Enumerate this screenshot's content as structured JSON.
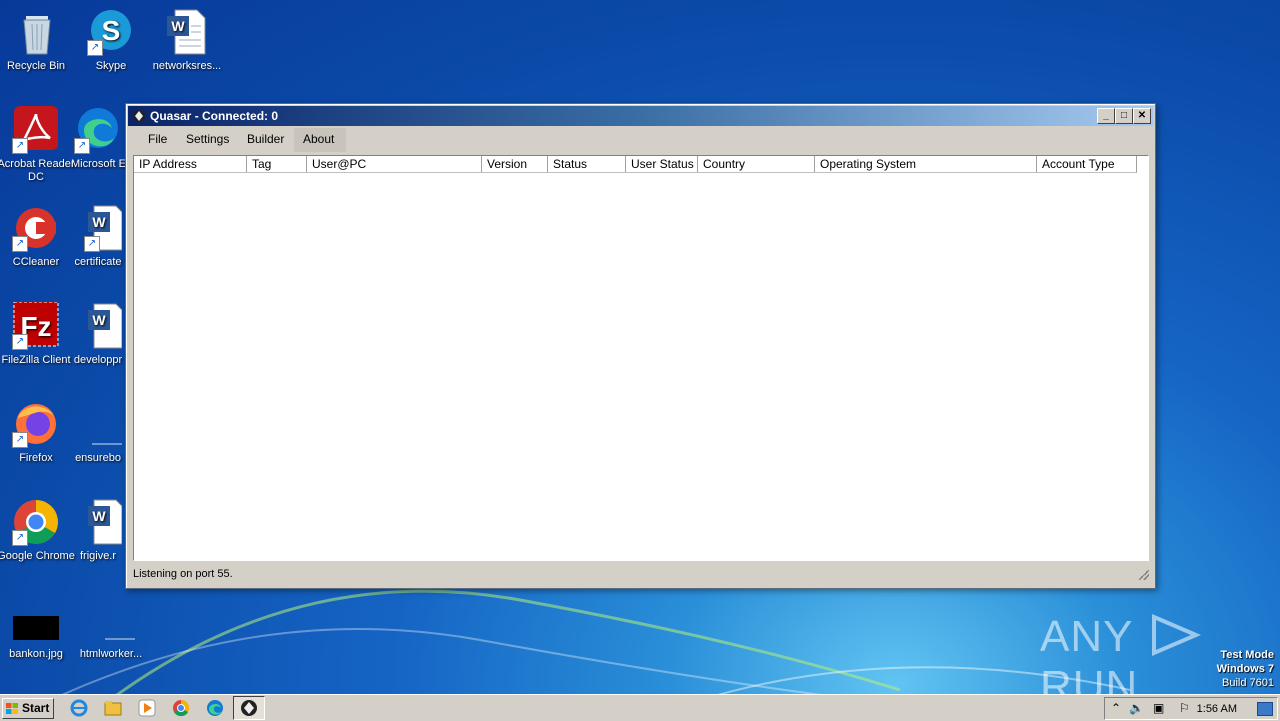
{
  "desktop": {
    "icons": [
      {
        "label": "Recycle Bin"
      },
      {
        "label": "Skype"
      },
      {
        "label": "networksres..."
      },
      {
        "label": "Acrobat Reader DC"
      },
      {
        "label": "Microsoft E"
      },
      {
        "label": "CCleaner"
      },
      {
        "label": "certificate"
      },
      {
        "label": "FileZilla Client"
      },
      {
        "label": "developpr"
      },
      {
        "label": "Firefox"
      },
      {
        "label": "ensurebo"
      },
      {
        "label": "Google Chrome"
      },
      {
        "label": "frigive.r"
      },
      {
        "label": "bankon.jpg"
      },
      {
        "label": "htmlworker..."
      }
    ]
  },
  "window": {
    "title": "Quasar - Connected: 0",
    "menu": [
      "File",
      "Settings",
      "Builder",
      "About"
    ],
    "columns": [
      "IP Address",
      "Tag",
      "User@PC",
      "Version",
      "Status",
      "User Status",
      "Country",
      "Operating System",
      "Account Type"
    ],
    "status": "Listening on port 55."
  },
  "watermark": {
    "brand_left": "ANY",
    "brand_right": "RUN",
    "line1": "Test Mode",
    "line2": "Windows 7",
    "line3": "Build 7601"
  },
  "taskbar": {
    "start_label": "Start",
    "clock": "1:56 AM"
  },
  "colors": {
    "titlebar_start": "#0a246a",
    "titlebar_end": "#a6caf0",
    "desktop": "#1564c4"
  }
}
